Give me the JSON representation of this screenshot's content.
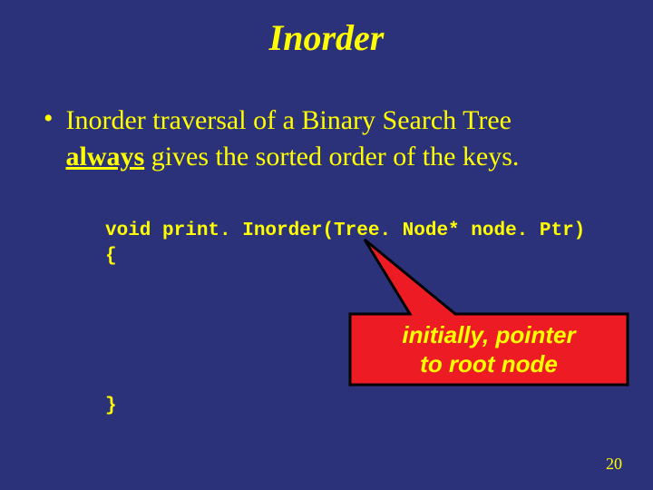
{
  "title": "Inorder",
  "bullet": {
    "line1": "Inorder traversal of a Binary Search Tree",
    "emph": "always",
    "rest": " gives the sorted order of the keys."
  },
  "code": {
    "sig": "void print. Inorder(Tree. Node* node. Ptr)",
    "open": "{",
    "close": "}"
  },
  "callout": {
    "line1": "initially, pointer",
    "line2": "to root node"
  },
  "colors": {
    "background": "#2b3279",
    "text": "#ffff00",
    "callout_fill": "#ed1c24",
    "callout_stroke": "#000000"
  },
  "page_number": "20"
}
